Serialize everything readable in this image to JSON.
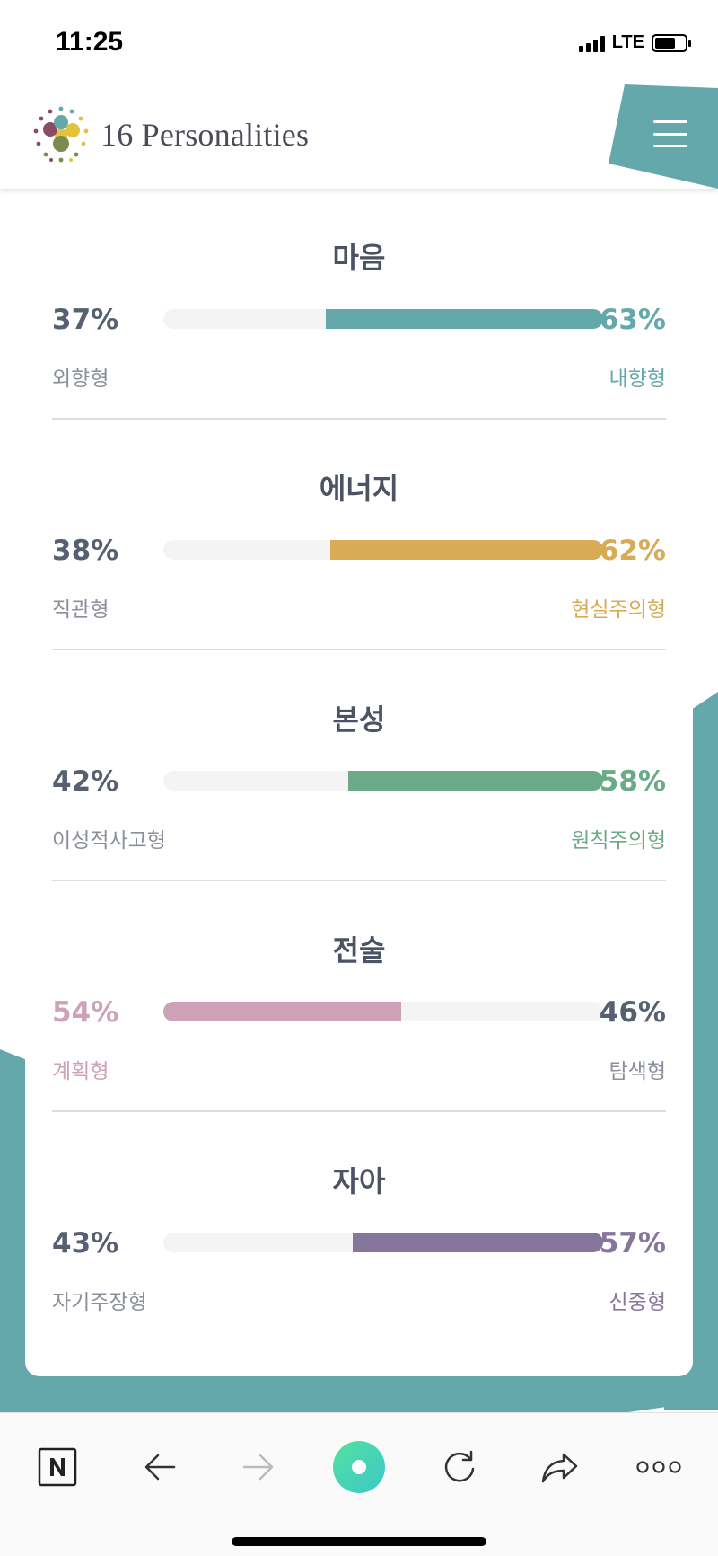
{
  "status_bar": {
    "time": "11:25",
    "network": "LTE"
  },
  "header": {
    "logo_text": "16 Personalities",
    "menu_icon": "hamburger-menu-icon"
  },
  "colors": {
    "teal": "#65a8ab",
    "mind": "#65a8ab",
    "energy": "#d8ab54",
    "nature": "#6aaa86",
    "tactics": "#cda2b9",
    "identity": "#87769b",
    "text_dark": "#576071",
    "text_light": "#8a8f99"
  },
  "traits": [
    {
      "title": "마음",
      "left_pct": "37%",
      "right_pct": "63%",
      "left_label": "외향형",
      "right_label": "내향형",
      "dominant": "right",
      "dominant_value": 0.63,
      "color": "#65a8ab"
    },
    {
      "title": "에너지",
      "left_pct": "38%",
      "right_pct": "62%",
      "left_label": "직관형",
      "right_label": "현실주의형",
      "dominant": "right",
      "dominant_value": 0.62,
      "color": "#d8ab54"
    },
    {
      "title": "본성",
      "left_pct": "42%",
      "right_pct": "58%",
      "left_label": "이성적사고형",
      "right_label": "원칙주의형",
      "dominant": "right",
      "dominant_value": 0.58,
      "color": "#6aaa86"
    },
    {
      "title": "전술",
      "left_pct": "54%",
      "right_pct": "46%",
      "left_label": "계획형",
      "right_label": "탐색형",
      "dominant": "left",
      "dominant_value": 0.54,
      "color": "#cda2b9"
    },
    {
      "title": "자아",
      "left_pct": "43%",
      "right_pct": "57%",
      "left_label": "자기주장형",
      "right_label": "신중형",
      "dominant": "right",
      "dominant_value": 0.57,
      "color": "#87769b"
    }
  ],
  "toolbar": {
    "buttons": [
      {
        "name": "naver-n-icon",
        "label": "N"
      },
      {
        "name": "back-arrow-icon"
      },
      {
        "name": "forward-arrow-icon"
      },
      {
        "name": "home-circle-icon"
      },
      {
        "name": "refresh-icon"
      },
      {
        "name": "share-icon"
      },
      {
        "name": "more-options-icon"
      }
    ]
  }
}
